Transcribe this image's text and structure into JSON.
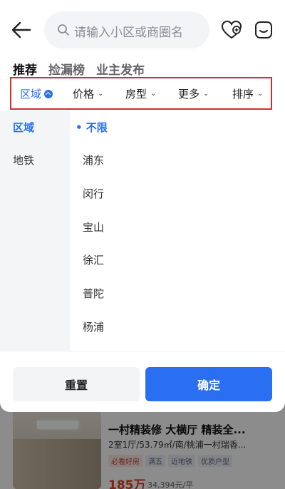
{
  "header": {
    "search_placeholder": "请输入小区或商圈名",
    "icons": [
      "back-arrow-icon",
      "search-icon",
      "favorite-heart-icon",
      "message-icon"
    ]
  },
  "tabs": [
    {
      "label": "推荐",
      "active": true
    },
    {
      "label": "捡漏榜",
      "active": false
    },
    {
      "label": "业主发布",
      "active": false
    }
  ],
  "filters": [
    {
      "label": "区域",
      "active": true
    },
    {
      "label": "价格",
      "active": false
    },
    {
      "label": "房型",
      "active": false
    },
    {
      "label": "更多",
      "active": false
    },
    {
      "label": "排序",
      "active": false
    }
  ],
  "left_menu": [
    {
      "label": "区域",
      "active": true
    },
    {
      "label": "地铁",
      "active": false
    }
  ],
  "right_menu": [
    {
      "label": "• 不限",
      "active": true
    },
    {
      "label": "浦东",
      "active": false
    },
    {
      "label": "闵行",
      "active": false
    },
    {
      "label": "宝山",
      "active": false
    },
    {
      "label": "徐汇",
      "active": false
    },
    {
      "label": "普陀",
      "active": false
    },
    {
      "label": "杨浦",
      "active": false
    }
  ],
  "footer": {
    "reset_label": "重置",
    "confirm_label": "确定"
  },
  "listing": {
    "title": "一村精装修 大横厅 精装全...",
    "subtitle": "2室1厅/53.79㎡/南/桃浦一村瑞香...",
    "tags": [
      "必看好房",
      "满五",
      "近地铁",
      "优质户型"
    ],
    "price": "185万",
    "unit_price": "34,394元/平"
  },
  "colors": {
    "accent": "#2a6ff2",
    "highlight_box": "#d32f2f",
    "price": "#e0402b"
  }
}
